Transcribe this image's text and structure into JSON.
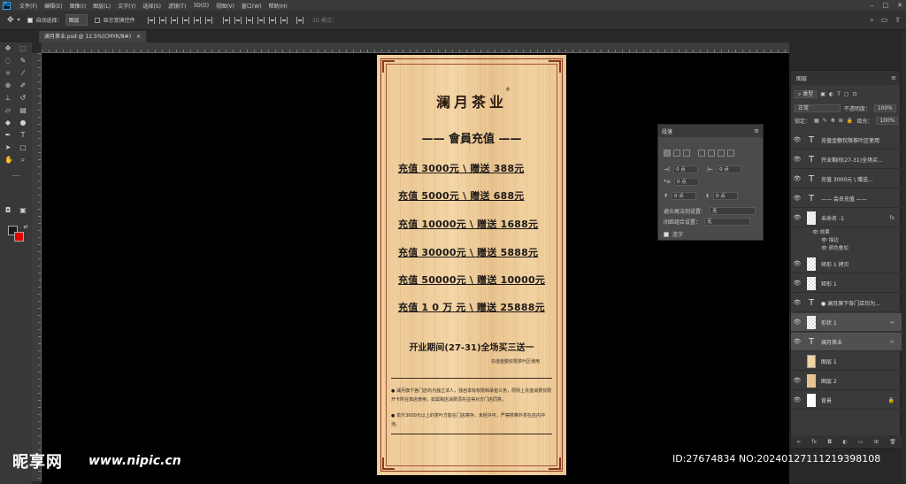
{
  "menubar": {
    "items": [
      "文件(F)",
      "编辑(E)",
      "图像(I)",
      "图层(L)",
      "文字(Y)",
      "选择(S)",
      "滤镜(T)",
      "3D(D)",
      "视图(V)",
      "窗口(W)",
      "帮助(H)"
    ]
  },
  "options": {
    "auto_select_label": "自动选择：",
    "auto_select_value": "图层",
    "transform_label": "显示变换控件",
    "mode_3d": "3D 模式："
  },
  "document": {
    "tab_title": "澜月茶业.psd @ 12.5%(CMYK/8#)"
  },
  "poster": {
    "brand": "澜月茶业",
    "brand_mark": "®",
    "member_title": "—— 會員充值 ——",
    "tiers": [
      "充值  3000元   \\ 赠送  388元",
      "充值  5000元   \\ 赠送  688元",
      "充值  10000元  \\ 赠送  1688元",
      "充值  30000元  \\ 赠送  5888元",
      "充值  50000元  \\ 赠送  10000元",
      "充值  1 0 万 元  \\ 赠送  25888元"
    ],
    "promo": "开业期间(27-31)全场买三送一",
    "promo_sub": "充值金额仅限茶叶区使用",
    "note1": "澜月旗下各门店均为独立法人，独自享有权限和承担义务，原则上充值消费仅限开卡所在单店使用，如需跨店消费须先征得对方门店同意。",
    "note2": "单斤3000元以上的茶叶方能在门店寄存，未经许可，严禁携带外茶在店内冲泡。"
  },
  "paragraph_panel": {
    "tab": "段落",
    "indent_left": "0 点",
    "indent_right": "0 点",
    "indent_first": "0 点",
    "space_before": "0 点",
    "space_after": "0 点",
    "kinsoku_label": "避头尾法则设置：",
    "kinsoku_value": "无",
    "mojikumi_label": "间距组合设置：",
    "mojikumi_value": "无",
    "hyphen_label": "连字"
  },
  "layers_panel": {
    "tab": "图层",
    "filter_kind": "类型",
    "blend_mode": "正常",
    "opacity_label": "不透明度：",
    "opacity_value": "100%",
    "lock_label": "锁定：",
    "fill_label": "填充：",
    "fill_value": "100%",
    "layers": [
      {
        "name": "充值金额仅限茶叶区使用",
        "kind": "text"
      },
      {
        "name": "开业期间(27-31)全场买...",
        "kind": "text"
      },
      {
        "name": "充值    3000元  \\  赠送...",
        "kind": "text"
      },
      {
        "name": "—— 会员充值 ——",
        "kind": "text"
      },
      {
        "name": "未命名 -1",
        "kind": "image",
        "fx": "fx"
      },
      {
        "name": "矩形 1 拷贝",
        "kind": "image"
      },
      {
        "name": "矩形 1",
        "kind": "image"
      },
      {
        "name": "● 澜月旗下各门店均为...",
        "kind": "text"
      },
      {
        "name": "形状 1",
        "kind": "image"
      },
      {
        "name": "澜月茶业",
        "kind": "text"
      },
      {
        "name": "图层 1",
        "kind": "tan"
      },
      {
        "name": "图层 2",
        "kind": "tan"
      },
      {
        "name": "背景",
        "kind": "white"
      }
    ],
    "effects_label": "效果",
    "effect_stroke": "描边",
    "effect_color": "颜色叠加"
  },
  "watermark": {
    "logo": "昵享网",
    "url": "www.nipic.cn",
    "id_text": "ID:27674834 NO:20240127111219398108"
  },
  "colors": {
    "foreground": "#1a1a1a",
    "background": "#e10000",
    "poster_wood": "#ecc996",
    "frame": "#8a3a20"
  }
}
